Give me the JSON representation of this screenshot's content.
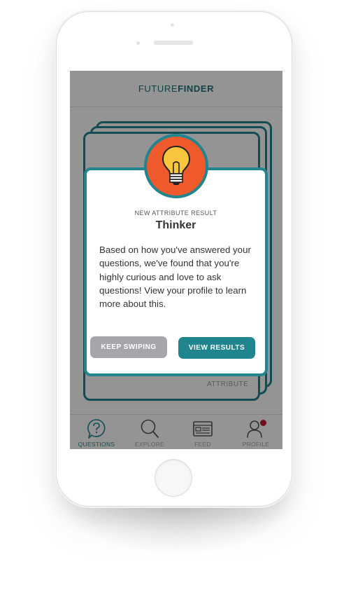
{
  "app": {
    "brand_light": "FUTURE",
    "brand_bold": "FINDER"
  },
  "background_card": {
    "tag": "ATTRIBUTE"
  },
  "modal": {
    "subtitle": "NEW ATTRIBUTE RESULT",
    "title": "Thinker",
    "body": "Based on how you've answered your questions, we've found that you're highly curious and love to ask questions! View your profile to learn more about this.",
    "icon": "lightbulb-icon",
    "keep_label": "KEEP SWIPING",
    "view_label": "VIEW RESULTS"
  },
  "tabs": [
    {
      "label": "QUESTIONS",
      "icon": "question-icon",
      "active": true
    },
    {
      "label": "EXPLORE",
      "icon": "search-icon",
      "active": false
    },
    {
      "label": "FEED",
      "icon": "feed-icon",
      "active": false
    },
    {
      "label": "PROFILE",
      "icon": "profile-icon",
      "active": false,
      "notification": true
    }
  ],
  "colors": {
    "teal": "#21858f",
    "icon_bg": "#ee5a2c",
    "bulb": "#f8c63c",
    "keep_button": "#a4a6ac",
    "badge": "#c01b2c"
  }
}
